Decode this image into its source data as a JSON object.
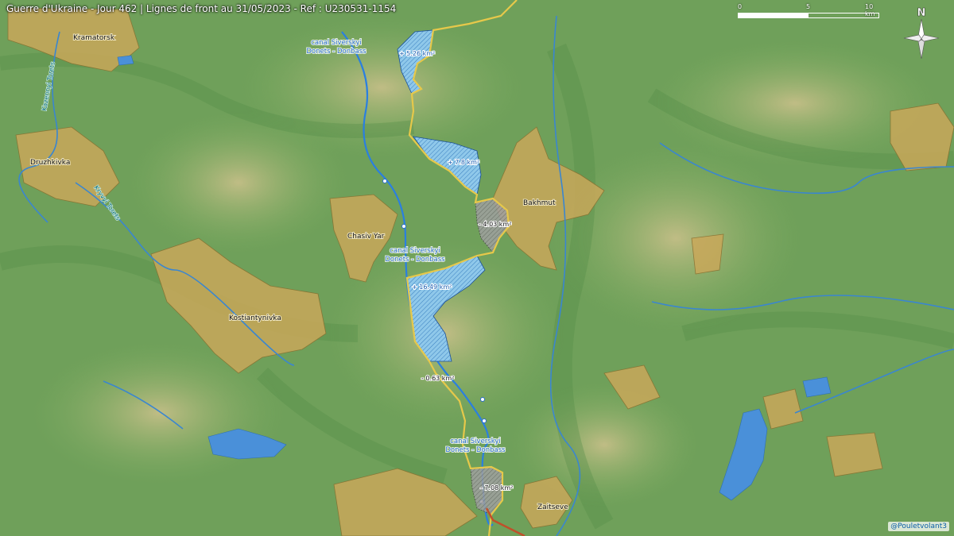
{
  "title": "Guerre d'Ukraine - Jour 462 | Lignes de front au 31/05/2023 - Ref : U230531-1154",
  "scale": {
    "ticks": [
      "0",
      "5",
      "10 km"
    ]
  },
  "north_label": "N",
  "credit": "@Pouletvolant3",
  "towns": {
    "kramatorsk": "Kramatorsk",
    "druzhkivka": "Druzhkivka",
    "bakhmut": "Bakhmut",
    "chasiv_yar": "Chasiv Yar",
    "kostiantynivka": "Kostiantynivka",
    "zaitseve": "Zaitseve"
  },
  "canal_labels": {
    "canal_1_line1": "canal Siverskyi",
    "canal_1_line2": "Donets - Donbass",
    "canal_2_line1": "canal Siverskyi",
    "canal_2_line2": "Donets - Donbass",
    "canal_3_line1": "canal Siverskyi",
    "canal_3_line2": "Donets - Donbass"
  },
  "rivers": {
    "kazennyi_torets": "Kazennyi Torets",
    "kryvyi_torets": "Kryvyi Torets"
  },
  "area_changes": {
    "north_gain": "+ 5.26 km²",
    "mid_gain": "+ 7.8 km²",
    "bakhmut_loss": "- 4.03 km²",
    "south_gain": "+ 16.49 km²",
    "small_loss": "- 0.63 km²",
    "south_loss": "- 7.08 km²"
  },
  "colors": {
    "terrain": "#6fa05a",
    "urban": "#c9a85a",
    "water": "#4a90d9",
    "front_line": "#e6c84a",
    "gain_fill": "#8fc8ea",
    "loss_fill": "#9a9a9a"
  }
}
